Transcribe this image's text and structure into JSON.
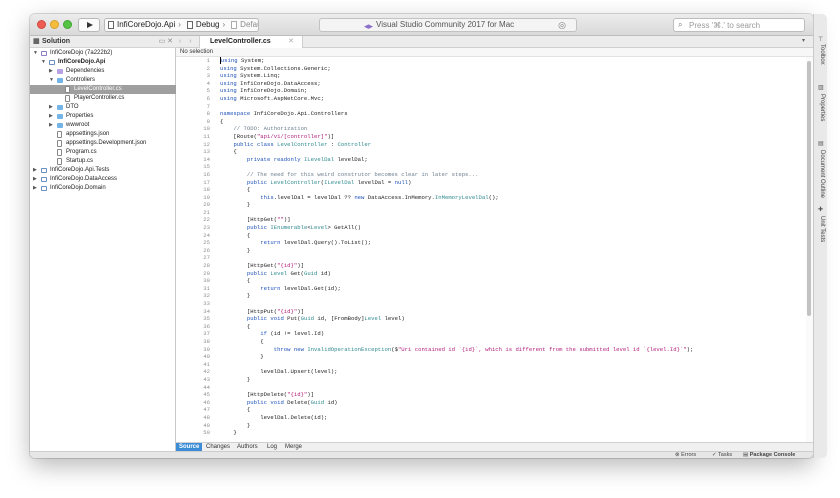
{
  "toolbar": {
    "project": "InfiCoreDojo.Api",
    "configuration": "Debug",
    "device": "Default",
    "status": "Visual Studio Community 2017 for Mac",
    "search_placeholder": "Press '⌘.' to search"
  },
  "solution_panel": {
    "title": "Solution",
    "items": [
      {
        "label": "InfiCoreDojo (7a222b2)",
        "depth": 0,
        "icon": "sln",
        "expanded": true
      },
      {
        "label": "InfiCoreDojo.Api",
        "depth": 1,
        "icon": "proj",
        "expanded": true,
        "bold": true
      },
      {
        "label": "Dependencies",
        "depth": 2,
        "icon": "folder-purple",
        "expanded": false
      },
      {
        "label": "Controllers",
        "depth": 2,
        "icon": "folder",
        "expanded": true
      },
      {
        "label": "LevelController.cs",
        "depth": 3,
        "icon": "file",
        "selected": true
      },
      {
        "label": "PlayerController.cs",
        "depth": 3,
        "icon": "file"
      },
      {
        "label": "DTO",
        "depth": 2,
        "icon": "folder",
        "expanded": false
      },
      {
        "label": "Properties",
        "depth": 2,
        "icon": "folder",
        "expanded": false
      },
      {
        "label": "wwwroot",
        "depth": 2,
        "icon": "folder",
        "expanded": false
      },
      {
        "label": "appsettings.json",
        "depth": 2,
        "icon": "file"
      },
      {
        "label": "appsettings.Development.json",
        "depth": 2,
        "icon": "file"
      },
      {
        "label": "Program.cs",
        "depth": 2,
        "icon": "file"
      },
      {
        "label": "Startup.cs",
        "depth": 2,
        "icon": "file"
      },
      {
        "label": "InfiCoreDojo.Api.Tests",
        "depth": 0,
        "icon": "proj",
        "expanded": false
      },
      {
        "label": "InfiCoreDojo.DataAccess",
        "depth": 0,
        "icon": "proj",
        "expanded": false
      },
      {
        "label": "InfiCoreDojo.Domain",
        "depth": 0,
        "icon": "proj",
        "expanded": false
      }
    ]
  },
  "editor": {
    "tab_label": "LevelController.cs",
    "selection_label": "No selection",
    "lines": [
      {
        "n": "1",
        "text": "using System;"
      },
      {
        "n": "2",
        "text": "using System.Collections.Generic;"
      },
      {
        "n": "3",
        "text": "using System.Linq;"
      },
      {
        "n": "4",
        "text": "using InfiCoreDojo.DataAccess;"
      },
      {
        "n": "5",
        "text": "using InfiCoreDojo.Domain;"
      },
      {
        "n": "6",
        "text": "using Microsoft.AspNetCore.Mvc;"
      },
      {
        "n": "7",
        "text": ""
      },
      {
        "n": "8",
        "text": "namespace InfiCoreDojo.Api.Controllers"
      },
      {
        "n": "9",
        "text": "{"
      },
      {
        "n": "10",
        "text": "    // TODO: Authorization"
      },
      {
        "n": "11",
        "text": "    [Route(\"api/v1/[controller]\")]"
      },
      {
        "n": "12",
        "text": "    public class LevelController : Controller"
      },
      {
        "n": "13",
        "text": "    {"
      },
      {
        "n": "14",
        "text": "        private readonly ILevelDal levelDal;"
      },
      {
        "n": "15",
        "text": ""
      },
      {
        "n": "16",
        "text": "        // The need for this weird construtor becomes clear in later steps..."
      },
      {
        "n": "17",
        "text": "        public LevelController(ILevelDal levelDal = null)"
      },
      {
        "n": "18",
        "text": "        {"
      },
      {
        "n": "19",
        "text": "            this.levelDal = levelDal ?? new DataAccess.InMemory.InMemoryLevelDal();"
      },
      {
        "n": "20",
        "text": "        }"
      },
      {
        "n": "21",
        "text": ""
      },
      {
        "n": "22",
        "text": "        [HttpGet(\"\")]"
      },
      {
        "n": "23",
        "text": "        public IEnumerable<Level> GetAll()"
      },
      {
        "n": "24",
        "text": "        {"
      },
      {
        "n": "25",
        "text": "            return levelDal.Query().ToList();"
      },
      {
        "n": "26",
        "text": "        }"
      },
      {
        "n": "27",
        "text": ""
      },
      {
        "n": "28",
        "text": "        [HttpGet(\"{id}\")]"
      },
      {
        "n": "29",
        "text": "        public Level Get(Guid id)"
      },
      {
        "n": "30",
        "text": "        {"
      },
      {
        "n": "31",
        "text": "            return levelDal.Get(id);"
      },
      {
        "n": "32",
        "text": "        }"
      },
      {
        "n": "33",
        "text": ""
      },
      {
        "n": "34",
        "text": "        [HttpPut(\"{id}\")]"
      },
      {
        "n": "35",
        "text": "        public void Put(Guid id, [FromBody]Level level)"
      },
      {
        "n": "36",
        "text": "        {"
      },
      {
        "n": "37",
        "text": "            if (id != level.Id)"
      },
      {
        "n": "38",
        "text": "            {"
      },
      {
        "n": "39",
        "text": "                throw new InvalidOperationException($\"Uri contained id `{id}`, which is different from the submitted level id `{level.Id}`\");"
      },
      {
        "n": "40",
        "text": "            }"
      },
      {
        "n": "41",
        "text": ""
      },
      {
        "n": "42",
        "text": "            levelDal.Upsert(level);"
      },
      {
        "n": "43",
        "text": "        }"
      },
      {
        "n": "44",
        "text": ""
      },
      {
        "n": "45",
        "text": "        [HttpDelete(\"{id}\")]"
      },
      {
        "n": "46",
        "text": "        public void Delete(Guid id)"
      },
      {
        "n": "47",
        "text": "        {"
      },
      {
        "n": "48",
        "text": "            levelDal.Delete(id);"
      },
      {
        "n": "49",
        "text": "        }"
      },
      {
        "n": "50",
        "text": "    }"
      }
    ]
  },
  "bottom_tabs": [
    "Source",
    "Changes",
    "Authors",
    "Log",
    "Merge"
  ],
  "status_bar": {
    "errors": "Errors",
    "tasks": "Tasks",
    "package_console": "Package Console"
  },
  "side_pads": [
    "Toolbox",
    "Properties",
    "Document Outline",
    "Unit Tests"
  ],
  "colors": {
    "accent": "#3c8dd6",
    "selection": "#9f9f9f",
    "keyword": "#1f53b8",
    "string": "#b21d7a",
    "comment": "#6e7f8e",
    "type": "#2e8a8f"
  }
}
